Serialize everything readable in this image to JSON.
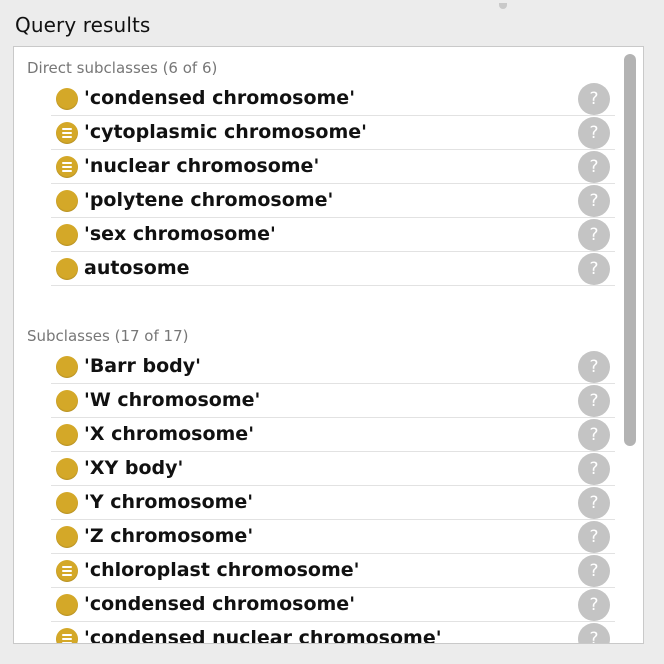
{
  "panel": {
    "title": "Query results"
  },
  "sections": [
    {
      "header": "Direct subclasses (6 of 6)",
      "items": [
        {
          "label": "'condensed chromosome'",
          "icon": "class-bullet-icon"
        },
        {
          "label": "'cytoplasmic chromosome'",
          "icon": "defined-class-bullet-icon"
        },
        {
          "label": "'nuclear chromosome'",
          "icon": "defined-class-bullet-icon"
        },
        {
          "label": "'polytene chromosome'",
          "icon": "class-bullet-icon"
        },
        {
          "label": "'sex chromosome'",
          "icon": "class-bullet-icon"
        },
        {
          "label": "autosome",
          "icon": "class-bullet-icon"
        }
      ]
    },
    {
      "header": "Subclasses (17 of 17)",
      "items": [
        {
          "label": "'Barr body'",
          "icon": "class-bullet-icon"
        },
        {
          "label": "'W chromosome'",
          "icon": "class-bullet-icon"
        },
        {
          "label": "'X chromosome'",
          "icon": "class-bullet-icon"
        },
        {
          "label": "'XY body'",
          "icon": "class-bullet-icon"
        },
        {
          "label": "'Y chromosome'",
          "icon": "class-bullet-icon"
        },
        {
          "label": "'Z chromosome'",
          "icon": "class-bullet-icon"
        },
        {
          "label": "'chloroplast chromosome'",
          "icon": "defined-class-bullet-icon"
        },
        {
          "label": "'condensed chromosome'",
          "icon": "class-bullet-icon"
        },
        {
          "label": "'condensed nuclear chromosome'",
          "icon": "defined-class-bullet-icon"
        }
      ]
    }
  ],
  "help_button": {
    "glyph": "?"
  },
  "colors": {
    "bullet": "#d4a828",
    "help": "#c4c4c4",
    "header_text": "#777777"
  }
}
